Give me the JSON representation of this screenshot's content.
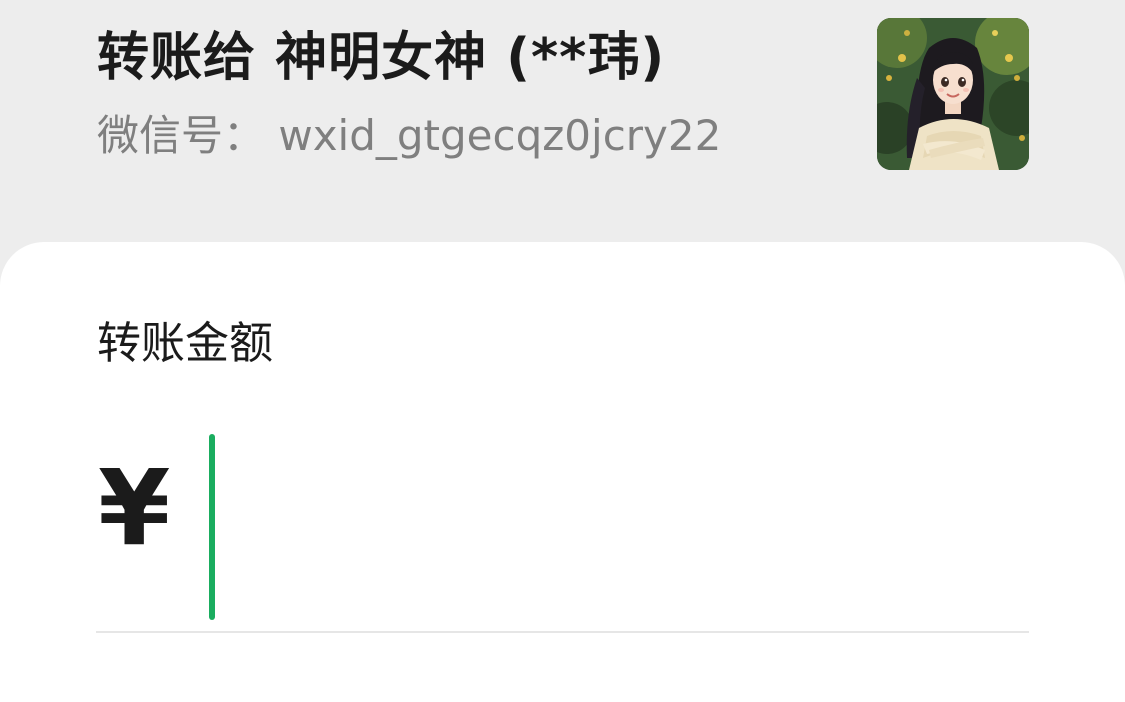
{
  "recipient": {
    "title": "转账给 神明女神 (**玮)",
    "wechat_id": "微信号： wxid_gtgecqz0jcry22",
    "avatar_icon": "user-avatar-icon"
  },
  "transfer": {
    "amount_label": "转账金额",
    "currency_symbol": "¥",
    "amount_value": "",
    "caret_color": "#1aad5f"
  },
  "colors": {
    "background": "#ededed",
    "card": "#ffffff",
    "accent": "#1aad5f"
  }
}
